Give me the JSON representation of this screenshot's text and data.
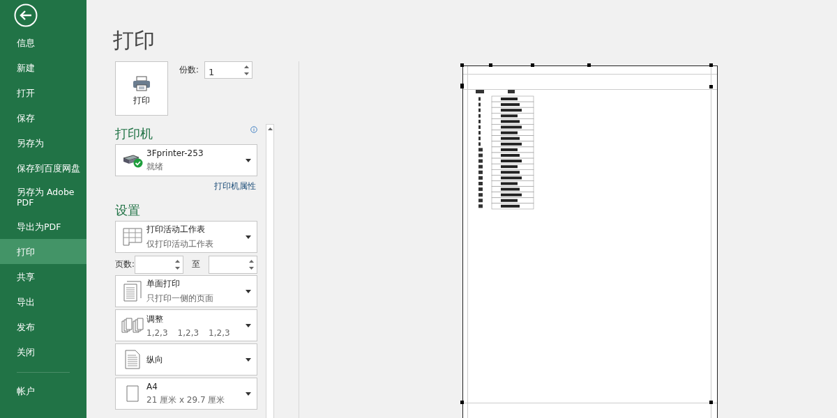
{
  "sidebar": {
    "items": [
      {
        "label": "信息",
        "selected": false
      },
      {
        "label": "新建",
        "selected": false
      },
      {
        "label": "打开",
        "selected": false
      },
      {
        "label": "保存",
        "selected": false
      },
      {
        "label": "另存为",
        "selected": false
      },
      {
        "label": "保存到百度网盘",
        "selected": false
      },
      {
        "label": "另存为 Adobe PDF",
        "selected": false
      },
      {
        "label": "导出为PDF",
        "selected": false
      },
      {
        "label": "打印",
        "selected": true
      },
      {
        "label": "共享",
        "selected": false
      },
      {
        "label": "导出",
        "selected": false
      },
      {
        "label": "发布",
        "selected": false
      },
      {
        "label": "关闭",
        "selected": false
      }
    ],
    "footer_items": [
      {
        "label": "帐户",
        "selected": false
      }
    ]
  },
  "page_title": "打印",
  "print_button": {
    "label": "打印"
  },
  "copies": {
    "label": "份数:",
    "value": "1"
  },
  "printer": {
    "heading": "打印机",
    "name": "3Fprinter-253",
    "status": "就绪",
    "ready": true,
    "properties_link": "打印机属性"
  },
  "settings": {
    "heading": "设置",
    "options": [
      {
        "kind": "sheet",
        "title": "打印活动工作表",
        "subtitle": "仅打印活动工作表"
      },
      {
        "kind": "range",
        "label": "页数:",
        "to_label": "至"
      },
      {
        "kind": "sides",
        "title": "单面打印",
        "subtitle": "只打印一侧的页面"
      },
      {
        "kind": "collate",
        "title": "调整",
        "subtitle_parts": [
          "1,2,3",
          "1,2,3",
          "1,2,3"
        ]
      },
      {
        "kind": "orientation",
        "title": "纵向"
      },
      {
        "kind": "paper",
        "title": "A4",
        "subtitle": "21 厘米 x 29.7 厘米"
      }
    ]
  }
}
